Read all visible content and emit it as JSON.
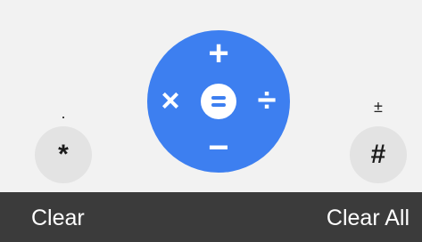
{
  "keys": {
    "left": {
      "hint": ".",
      "glyph": "*",
      "icon": "asterisk-icon"
    },
    "right": {
      "hint": "±",
      "glyph": "#",
      "icon": "hash-icon"
    }
  },
  "operator_wheel": {
    "plus": "+",
    "minus": "−",
    "times": "×",
    "divide": "÷",
    "equals_icon": "equals-icon",
    "accent_color": "#3d7ff0"
  },
  "bottom_bar": {
    "left_label": "Clear",
    "right_label": "Clear All",
    "background_color": "#3b3b3b"
  }
}
